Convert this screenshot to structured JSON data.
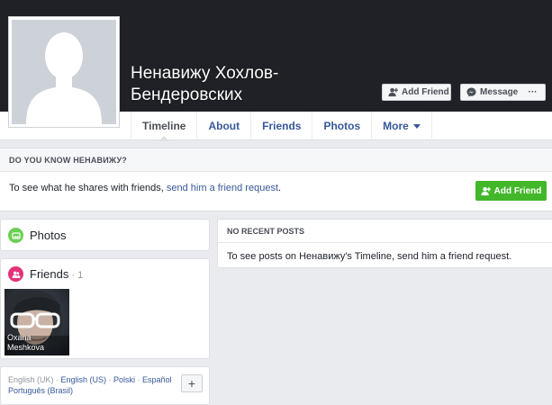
{
  "profile": {
    "name_line1": "Ненавижу Хохлов-",
    "name_line2": "Бендеровских"
  },
  "actions": {
    "add_friend": "Add Friend",
    "message": "Message",
    "more": "···"
  },
  "tabs": [
    {
      "label": "Timeline"
    },
    {
      "label": "About"
    },
    {
      "label": "Friends"
    },
    {
      "label": "Photos"
    },
    {
      "label": "More"
    }
  ],
  "know": {
    "heading": "DO YOU KNOW НЕНАВИЖУ?",
    "text_prefix": "To see what he shares with friends, ",
    "link": "send him a friend request",
    "text_suffix": ".",
    "button": "Add Friend"
  },
  "photos": {
    "title": "Photos"
  },
  "friends": {
    "title": "Friends",
    "count": " · 1",
    "items": [
      {
        "name_line1": "Oxana",
        "name_line2": "Meshkova"
      }
    ]
  },
  "languages": {
    "current": "English (UK)",
    "others": [
      "English (US)",
      "Polski",
      "Español",
      "Português (Brasil)"
    ],
    "separator": " · ",
    "add": "+"
  },
  "posts": {
    "heading": "NO RECENT POSTS",
    "text": "To see posts on Ненавижу's Timeline, send him a friend request."
  },
  "colors": {
    "cover": "#1f2126",
    "link": "#365899",
    "green": "#42b72a",
    "photos_icon": "#6bcf55",
    "friends_icon": "#e3327a"
  },
  "icons": {
    "add_friend": "add-friend-icon",
    "message": "messenger-icon",
    "photos": "photos-icon",
    "friends": "friends-icon"
  }
}
